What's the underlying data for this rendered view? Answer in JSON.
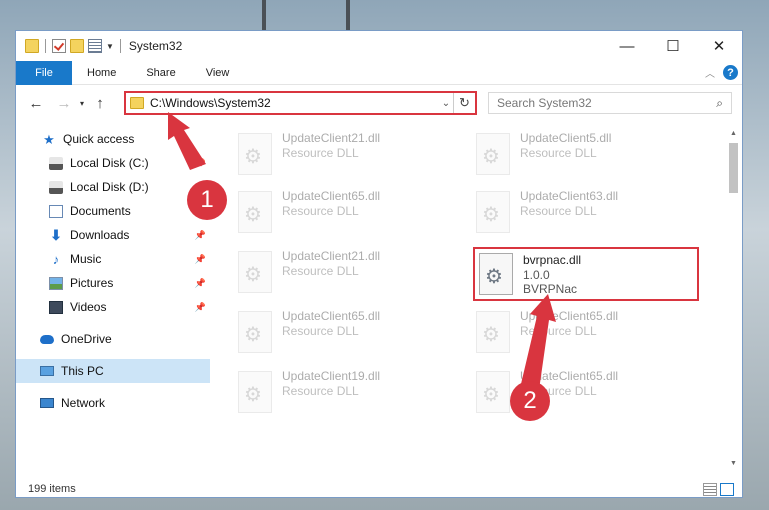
{
  "window": {
    "title": "System32"
  },
  "titlebar": {
    "minimize": "—",
    "maximize": "☐",
    "close": "✕"
  },
  "ribbon": {
    "tabs": [
      "File",
      "Home",
      "Share",
      "View"
    ],
    "collapse_icon": "chevron-up-icon",
    "help_icon": "?"
  },
  "nav": {
    "back": "←",
    "forward": "→",
    "recent": "▾",
    "up": "↑",
    "address": "C:\\Windows\\System32",
    "refresh": "↻",
    "search_placeholder": "Search System32",
    "search_glyph": "⌕"
  },
  "sidebar": {
    "items": [
      {
        "label": "Quick access",
        "icon": "star-icon",
        "pinned": false
      },
      {
        "label": "Local Disk (C:)",
        "icon": "drive-icon",
        "pinned": true
      },
      {
        "label": "Local Disk (D:)",
        "icon": "drive-icon",
        "pinned": false
      },
      {
        "label": "Documents",
        "icon": "documents-icon",
        "pinned": false
      },
      {
        "label": "Downloads",
        "icon": "downloads-icon",
        "pinned": true
      },
      {
        "label": "Music",
        "icon": "music-icon",
        "pinned": true
      },
      {
        "label": "Pictures",
        "icon": "pictures-icon",
        "pinned": true
      },
      {
        "label": "Videos",
        "icon": "videos-icon",
        "pinned": true
      },
      {
        "label": "OneDrive",
        "icon": "onedrive-icon",
        "pinned": false
      },
      {
        "label": "This PC",
        "icon": "this-pc-icon",
        "selected": true
      },
      {
        "label": "Network",
        "icon": "network-icon",
        "pinned": false
      }
    ],
    "pin_glyph": "📌"
  },
  "files": [
    {
      "name": "UpdateClient21.dll",
      "type": "Resource DLL"
    },
    {
      "name": "UpdateClient5.dll",
      "type": "Resource DLL"
    },
    {
      "name": "UpdateClient65.dll",
      "type": "Resource DLL"
    },
    {
      "name": "UpdateClient63.dll",
      "type": "Resource DLL"
    },
    {
      "name": "UpdateClient21.dll",
      "type": "Resource DLL"
    },
    {
      "name": "bvrpnac.dll",
      "version": "1.0.0",
      "description": "BVRPNac"
    },
    {
      "name": "UpdateClient65.dll",
      "type": "Resource DLL"
    },
    {
      "name": "UpdateClient65.dll",
      "type": "Resource DLL"
    },
    {
      "name": "UpdateClient19.dll",
      "type": "Resource DLL"
    },
    {
      "name": "UpdateClient65.dll",
      "type": "Resource DLL"
    }
  ],
  "status": {
    "item_count": "199 items"
  },
  "callouts": [
    "1",
    "2"
  ],
  "colors": {
    "accent": "#1979ca",
    "highlight": "#d9353f",
    "selected": "#cce4f7"
  }
}
